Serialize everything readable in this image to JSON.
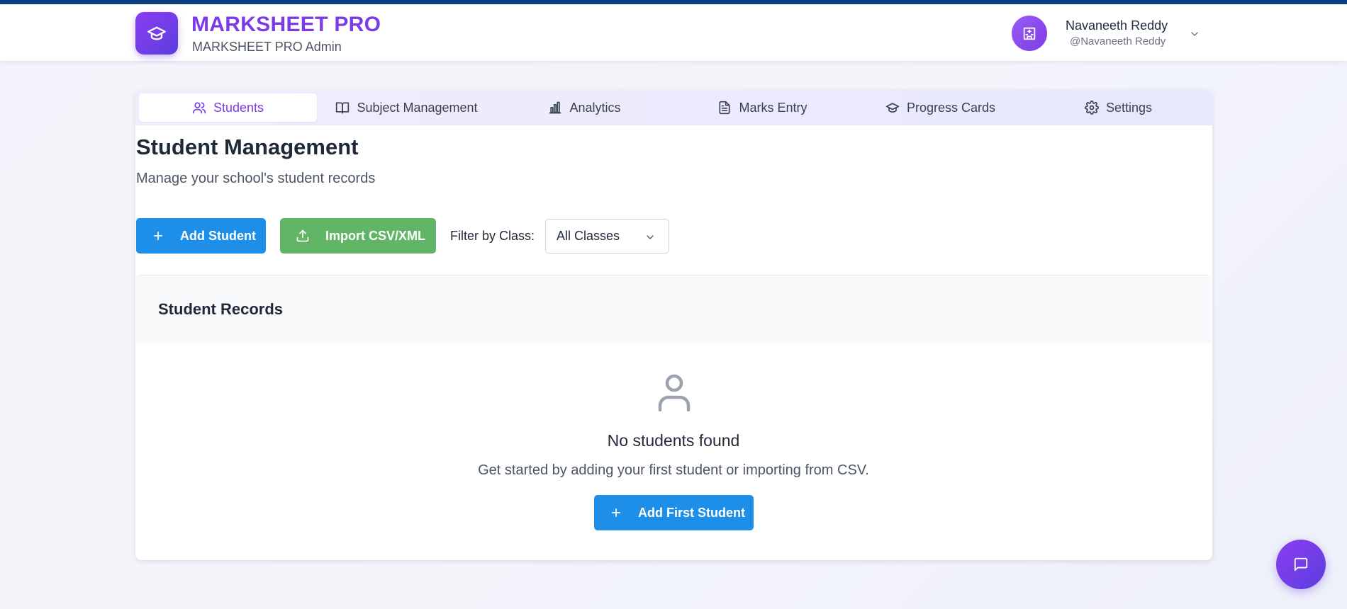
{
  "header": {
    "brand_title": "MARKSHEET PRO",
    "brand_subtitle": "MARKSHEET PRO Admin",
    "logo_icon": "graduation-cap-icon",
    "user": {
      "name": "Navaneeth Reddy",
      "handle": "@Navaneeth Reddy",
      "avatar_icon": "school-building-icon"
    }
  },
  "tabs": [
    {
      "label": "Students",
      "icon": "users-icon",
      "active": true
    },
    {
      "label": "Subject Management",
      "icon": "book-open-icon",
      "active": false
    },
    {
      "label": "Analytics",
      "icon": "bar-chart-icon",
      "active": false
    },
    {
      "label": "Marks Entry",
      "icon": "file-text-icon",
      "active": false
    },
    {
      "label": "Progress Cards",
      "icon": "graduation-cap-icon",
      "active": false
    },
    {
      "label": "Settings",
      "icon": "gear-icon",
      "active": false
    }
  ],
  "page": {
    "title": "Student Management",
    "subtitle": "Manage your school's student records"
  },
  "toolbar": {
    "add_label": "Add Student",
    "import_label": "Import CSV/XML",
    "filter_label": "Filter by Class:",
    "filter_value": "All Classes"
  },
  "records": {
    "title": "Student Records",
    "empty_title": "No students found",
    "empty_subtitle": "Get started by adding your first student or importing from CSV.",
    "empty_button": "Add First Student"
  },
  "colors": {
    "brand_purple": "#7b3ce6",
    "primary_blue": "#1e8fe8",
    "import_green": "#62b566",
    "top_stripe": "#0b3d7e"
  }
}
